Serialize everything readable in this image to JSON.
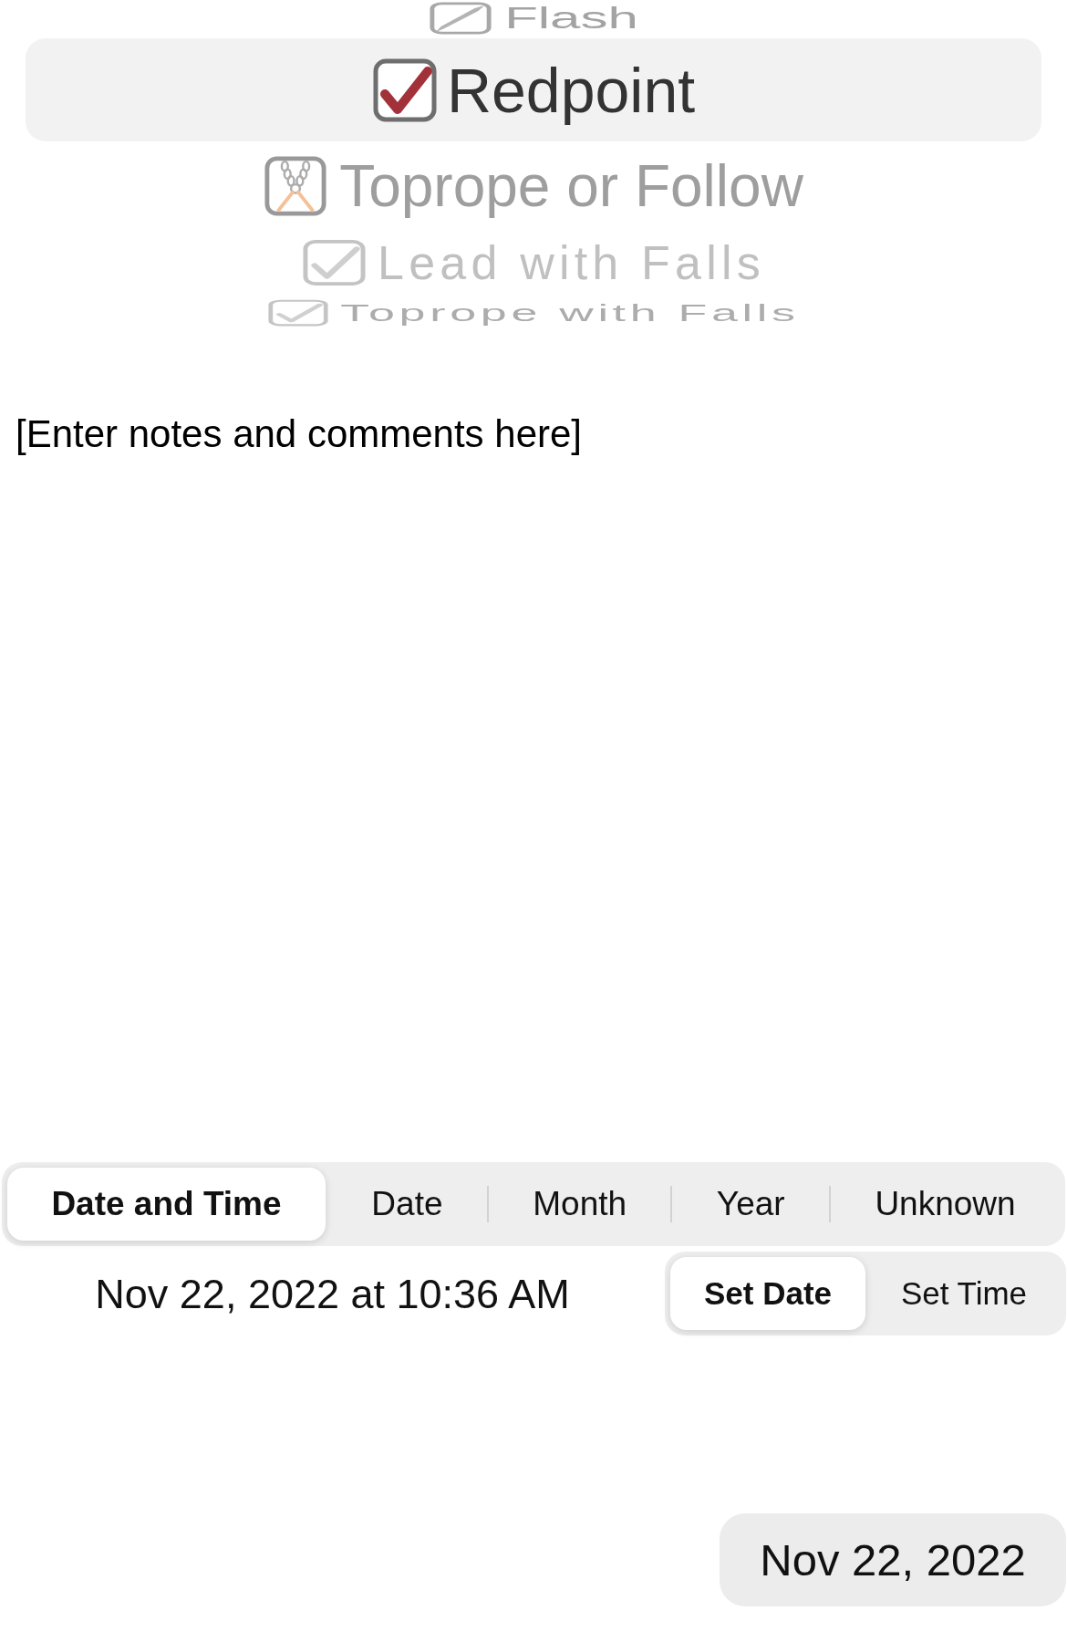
{
  "picker": {
    "options": [
      {
        "label": "Flash",
        "kind": "slash",
        "selected": false
      },
      {
        "label": "Redpoint",
        "kind": "check",
        "selected": true
      },
      {
        "label": "Toprope or Follow",
        "kind": "chains",
        "selected": false
      },
      {
        "label": "Lead with Falls",
        "kind": "check",
        "selected": false
      },
      {
        "label": "Toprope with Falls",
        "kind": "check",
        "selected": false
      }
    ]
  },
  "notes": {
    "value": "[Enter notes and comments here]"
  },
  "date_mode_tabs": [
    {
      "label": "Date and Time",
      "selected": true
    },
    {
      "label": "Date",
      "selected": false
    },
    {
      "label": "Month",
      "selected": false
    },
    {
      "label": "Year",
      "selected": false
    },
    {
      "label": "Unknown",
      "selected": false
    }
  ],
  "date_row": {
    "value": "Nov 22, 2022 at 10:36 AM",
    "tabs": [
      {
        "label": "Set Date",
        "selected": true
      },
      {
        "label": "Set Time",
        "selected": false
      }
    ]
  },
  "date_button": {
    "label": "Nov 22, 2022"
  }
}
